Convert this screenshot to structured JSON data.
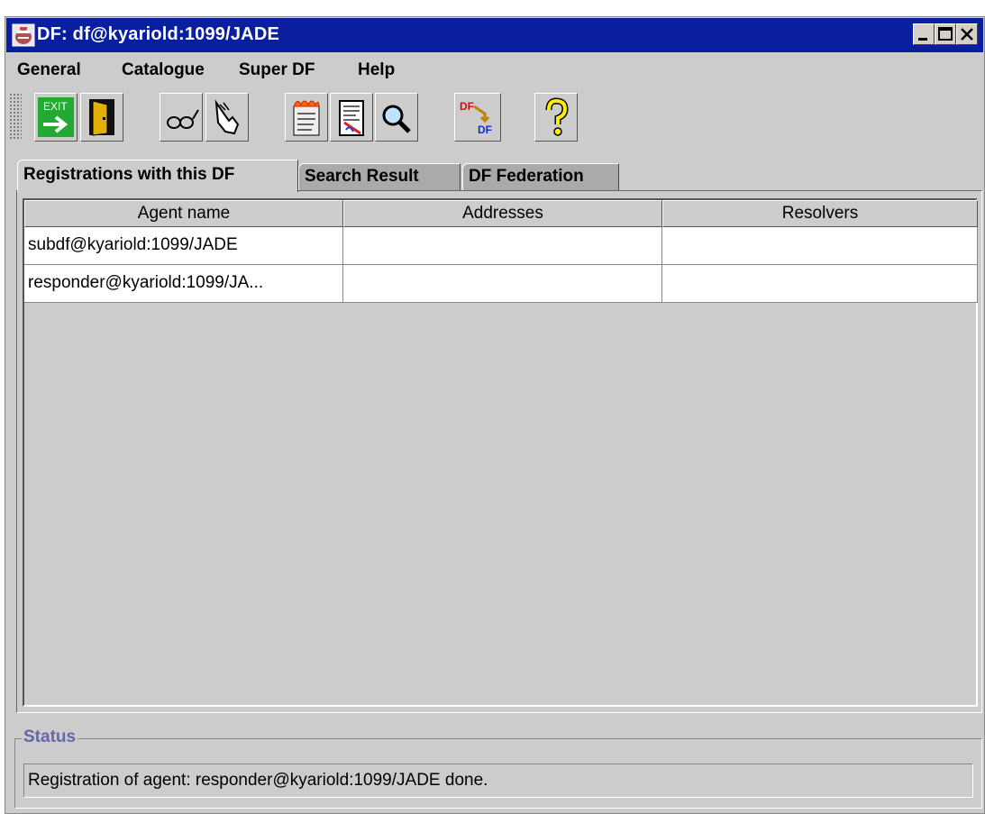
{
  "window": {
    "title": "DF: df@kyariold:1099/JADE",
    "title_bar_color": "#0a1ea0"
  },
  "menubar": {
    "items": [
      {
        "label": "General"
      },
      {
        "label": "Catalogue"
      },
      {
        "label": "Super DF"
      },
      {
        "label": "Help"
      }
    ]
  },
  "toolbar": {
    "buttons": [
      {
        "icon": "exit-icon",
        "label": "EXIT"
      },
      {
        "icon": "door-icon"
      },
      {
        "icon": "glasses-icon"
      },
      {
        "icon": "hand-icon"
      },
      {
        "icon": "burning-document-icon"
      },
      {
        "icon": "edit-document-icon"
      },
      {
        "icon": "magnifier-icon"
      },
      {
        "icon": "federate-df-icon",
        "label_top": "DF",
        "label_bottom": "DF"
      },
      {
        "icon": "help-icon"
      }
    ]
  },
  "tabs": [
    {
      "label": "Registrations with this DF",
      "active": true
    },
    {
      "label": "Search Result",
      "active": false
    },
    {
      "label": "DF Federation",
      "active": false
    }
  ],
  "table": {
    "columns": [
      "Agent name",
      "Addresses",
      "Resolvers"
    ],
    "rows": [
      [
        "subdf@kyariold:1099/JADE",
        "",
        ""
      ],
      [
        "responder@kyariold:1099/JA...",
        "",
        ""
      ]
    ]
  },
  "status": {
    "legend": "Status",
    "text": "Registration of agent: responder@kyariold:1099/JADE done."
  }
}
